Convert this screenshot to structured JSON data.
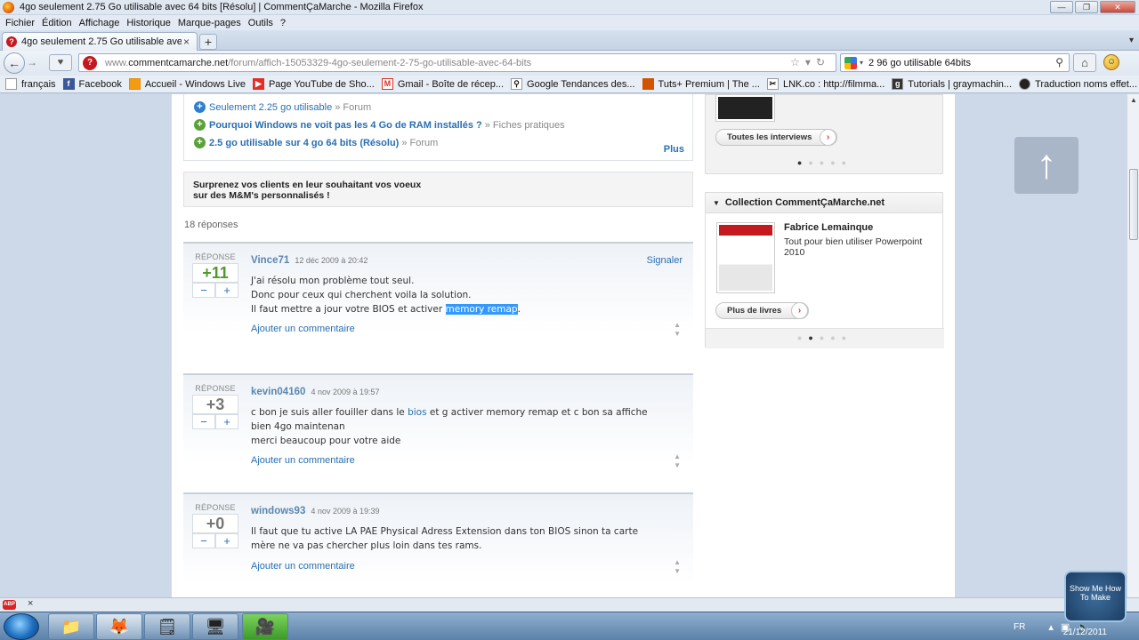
{
  "window": {
    "title": "4go seulement 2.75 Go utilisable avec 64 bits [Résolu] | CommentÇaMarche - Mozilla Firefox"
  },
  "menu": [
    "Fichier",
    "Édition",
    "Affichage",
    "Historique",
    "Marque-pages",
    "Outils",
    "?"
  ],
  "tab": {
    "label": "4go seulement 2.75 Go utilisable avec 64...",
    "close": "×",
    "new": "+"
  },
  "nav": {
    "url_prefix": "www.",
    "url_domain": "commentcamarche.net",
    "url_path": "/forum/affich-15053329-4go-seulement-2-75-go-utilisable-avec-64-bits",
    "search_value": "2 96 go utilisable 64bits"
  },
  "bookmarks": [
    {
      "label": "français",
      "icon": "page-icon"
    },
    {
      "label": "Facebook",
      "icon": "facebook-icon"
    },
    {
      "label": "Accueil - Windows Live",
      "icon": "windows-live-icon"
    },
    {
      "label": "Page YouTube de Sho...",
      "icon": "youtube-icon"
    },
    {
      "label": "Gmail - Boîte de récep...",
      "icon": "gmail-icon"
    },
    {
      "label": "Google Tendances des...",
      "icon": "google-trends-icon"
    },
    {
      "label": "Tuts+ Premium | The ...",
      "icon": "tuts-icon"
    },
    {
      "label": "LNK.co : http://filmma...",
      "icon": "lnk-icon"
    },
    {
      "label": "Tutorials | graymachin...",
      "icon": "graymachine-icon"
    },
    {
      "label": "Traduction noms effet...",
      "icon": "traduction-icon"
    }
  ],
  "related": [
    {
      "title": "Seulement 2.25 go utilisable",
      "suffix": "» Forum",
      "color": "#2f7fd1"
    },
    {
      "title": "Pourquoi Windows ne voit pas les 4 Go de RAM installés ?",
      "suffix": "» Fiches pratiques",
      "color": "#5aa13a"
    },
    {
      "title": "2.5 go utilisable sur 4 go 64 bits (Résolu)",
      "suffix": "» Forum",
      "color": "#5aa13a"
    }
  ],
  "related_more": "Plus",
  "promo": {
    "line1": "Surprenez vos clients en leur souhaitant vos voeux",
    "line2": "sur des M&M's personnalisés !"
  },
  "answers_count": "18 réponses",
  "answers": [
    {
      "rep_label": "RÉPONSE",
      "score": "+11",
      "minus": "−",
      "plus": "+",
      "author": "Vince71",
      "date": "12 déc 2009 à 20:42",
      "report": "Signaler",
      "line1": "J'ai résolu mon problème tout seul.",
      "line2": "Donc pour ceux qui cherchent voila la solution.",
      "line3_pre": "Il faut mettre a jour votre BIOS et activer ",
      "line3_hl": "memory remap",
      "line3_post": ".",
      "add_comment": "Ajouter un commentaire"
    },
    {
      "rep_label": "RÉPONSE",
      "score": "+3",
      "minus": "−",
      "plus": "+",
      "author": "kevin04160",
      "date": "4 nov 2009 à 19:57",
      "line1_pre": "c bon je suis aller fouiller dans le ",
      "line1_link": "bios",
      "line1_post": " et g activer memory remap et c bon sa affiche",
      "line2": "bien 4go maintenan",
      "line3": "merci beaucoup pour votre aide",
      "add_comment": "Ajouter un commentaire"
    },
    {
      "rep_label": "RÉPONSE",
      "score": "+0",
      "minus": "−",
      "plus": "+",
      "author": "windows93",
      "date": "4 nov 2009 à 19:39",
      "line1": "Il faut que tu active LA PAE Physical Adress Extension dans ton BIOS sinon ta carte",
      "line2": "mère ne va pas chercher plus loin dans tes rams.",
      "add_comment": "Ajouter un commentaire"
    }
  ],
  "sidebar": {
    "interviews_button": "Toutes les interviews",
    "collection_title": "Collection CommentÇaMarche.net",
    "book_author": "Fabrice Lemainque",
    "book_desc": "Tout pour bien utiliser Powerpoint 2010",
    "more_books_button": "Plus de livres"
  },
  "taskbar": {
    "lang": "FR",
    "date": "21/12/2011"
  },
  "watermark": "Show Me How To Make",
  "colors": {
    "accent": "#2a6fb0",
    "score_green": "#4f9a2e",
    "highlight": "#3399ff",
    "ccm_red": "#c4191f"
  }
}
